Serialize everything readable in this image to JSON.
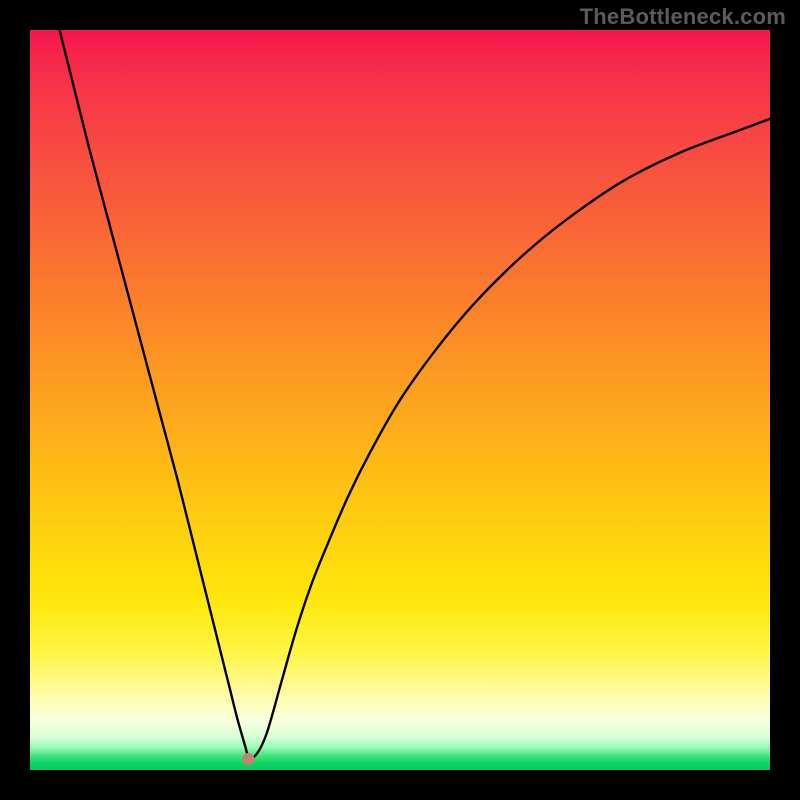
{
  "watermark": "TheBottleneck.com",
  "chart_data": {
    "type": "line",
    "title": "",
    "xlabel": "",
    "ylabel": "",
    "xlim": [
      0,
      100
    ],
    "ylim": [
      0,
      100
    ],
    "grid": false,
    "legend": false,
    "series": [
      {
        "name": "bottleneck-curve",
        "x": [
          4,
          6,
          8,
          10,
          12,
          14,
          16,
          18,
          20,
          22,
          24,
          25,
          26,
          27,
          28,
          29,
          29.5,
          30.5,
          32,
          34,
          36,
          38,
          40,
          43,
          46,
          50,
          55,
          60,
          66,
          72,
          80,
          88,
          96,
          100
        ],
        "values": [
          100,
          92,
          84,
          76.5,
          69,
          61.5,
          54,
          46.5,
          39,
          31,
          23,
          19,
          15,
          11,
          7,
          3.5,
          2,
          2,
          5,
          12,
          19,
          25,
          30,
          37,
          43,
          50,
          57,
          63,
          69,
          74,
          79.5,
          83.5,
          86.5,
          88
        ]
      }
    ],
    "marker": {
      "name": "marker-dot",
      "x": 29.5,
      "y": 1.5,
      "color": "#c98075"
    },
    "colors": {
      "curve": "#000000",
      "gradient_top": "#f5174b",
      "gradient_mid": "#fecf0e",
      "gradient_bottom": "#06c95d"
    }
  }
}
